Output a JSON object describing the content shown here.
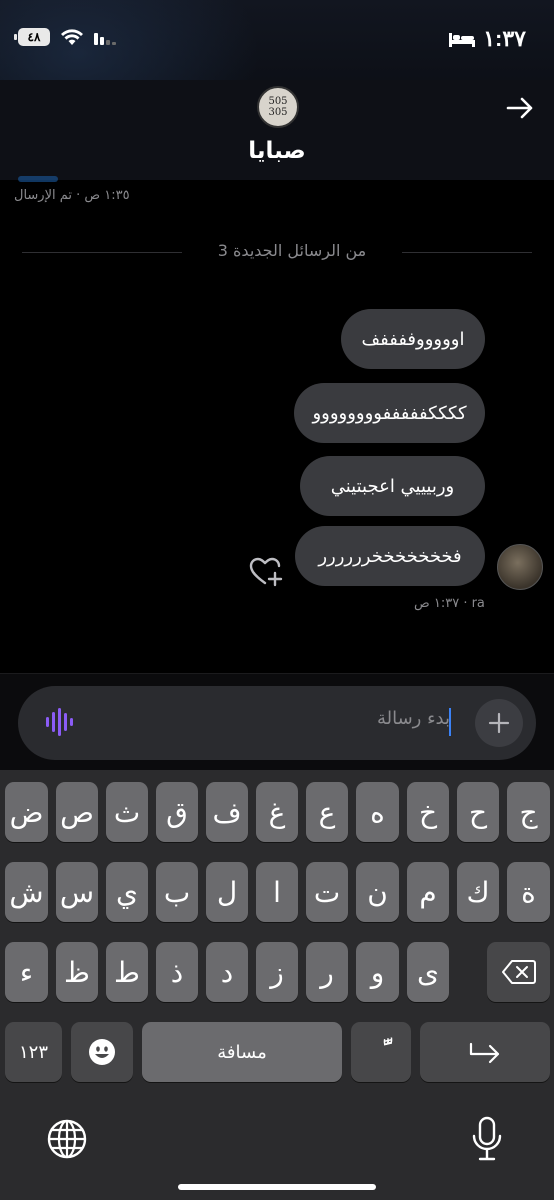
{
  "status_bar": {
    "time": "١:٣٧",
    "battery": "٤٨"
  },
  "header": {
    "avatar_text": "505\n305",
    "name": "صبايا"
  },
  "previous_status": "١:٣٥ ص · تم الإرسال",
  "new_messages_label": "3 من الرسائل الجديدة",
  "messages": [
    {
      "text": "اوووووففففف"
    },
    {
      "text": "ككككفففففوووووووو"
    },
    {
      "text": "وربيييي اعجبتيني"
    },
    {
      "text": "فخخخخخخخرررررر"
    }
  ],
  "message_meta": "١:٣٧ ص · ra",
  "composer": {
    "placeholder": "بدء رسالة"
  },
  "keyboard": {
    "row1": [
      "ض",
      "ص",
      "ث",
      "ق",
      "ف",
      "غ",
      "ع",
      "ه",
      "خ",
      "ح",
      "ج"
    ],
    "row2": [
      "ش",
      "س",
      "ي",
      "ب",
      "ل",
      "ا",
      "ت",
      "ن",
      "م",
      "ك",
      "ة"
    ],
    "row3": [
      "ء",
      "ظ",
      "ط",
      "ذ",
      "د",
      "ز",
      "ر",
      "و",
      "ى"
    ],
    "numbers_key": "١٢٣",
    "space_key": "مسافة",
    "diacritic_key": "ًّ"
  }
}
